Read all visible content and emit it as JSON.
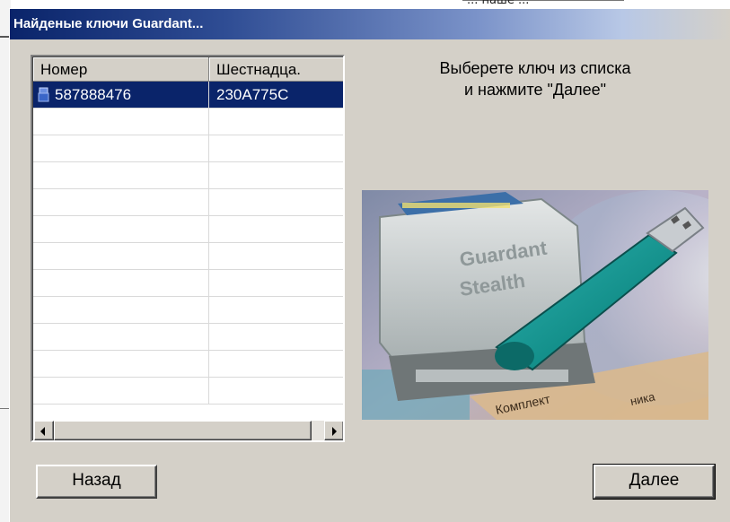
{
  "background": {
    "top_text": "... наше ..."
  },
  "dialog": {
    "title": "Найденые ключи Guardant...",
    "list": {
      "columns": [
        "Номер",
        "Шестнадца."
      ],
      "rows": [
        {
          "number": "587888476",
          "hex": "230A775C",
          "selected": true,
          "icon": "key-icon"
        }
      ],
      "empty_rows": 11
    },
    "instruction": {
      "line1": "Выберете ключ из списка",
      "line2": "и нажмите \"Далее\""
    },
    "photo": {
      "label1": "Guardant",
      "label2": "Stealth",
      "label3": "Комплект",
      "label4": "ника"
    },
    "buttons": {
      "back": "Назад",
      "next": "Далее"
    },
    "colors": {
      "title_start": "#0a246a",
      "selection": "#0a246a",
      "face": "#d4d0c8"
    }
  }
}
